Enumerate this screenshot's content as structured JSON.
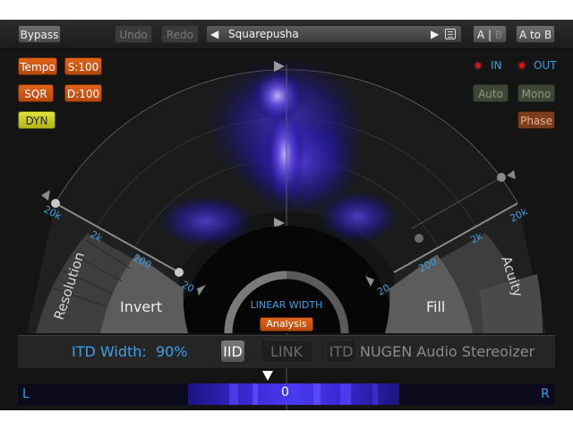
{
  "toolbar": {
    "bypass": "Bypass",
    "undo": "Undo",
    "redo": "Redo",
    "preset_name": "Squarepusha",
    "ab_a": "A",
    "ab_sep": "|",
    "ab_b": "B",
    "a_to_b": "A to B"
  },
  "left_controls": {
    "tempo": "Tempo",
    "s100": "S:100",
    "sqr": "SQR",
    "d100": "D:100",
    "dyn": "DYN"
  },
  "right_controls": {
    "in": "IN",
    "out": "OUT",
    "auto": "Auto",
    "mono": "Mono",
    "phase": "Phase"
  },
  "display": {
    "left_freq_labels": [
      "20k",
      "2k",
      "200",
      "20"
    ],
    "right_freq_labels": [
      "20",
      "200",
      "2k",
      "20k"
    ],
    "resolution": "Resolution",
    "invert": "Invert",
    "fill": "Fill",
    "acuity": "Acuity",
    "linear_width": "LINEAR WIDTH",
    "analysis": "Analysis"
  },
  "bottom": {
    "itd_width": "ITD Width:  90%",
    "iid": "IID",
    "link": "LINK",
    "itd": "ITD",
    "brand": "NUGEN Audio Stereoizer"
  },
  "meter": {
    "left": "L",
    "center": "0",
    "right": "R"
  },
  "colors": {
    "accent_blue": "#3aa0e8",
    "orange": "#d8581a",
    "yellow": "#d4d628",
    "led_red": "#d01818",
    "field_purple": "#3a28c0"
  }
}
